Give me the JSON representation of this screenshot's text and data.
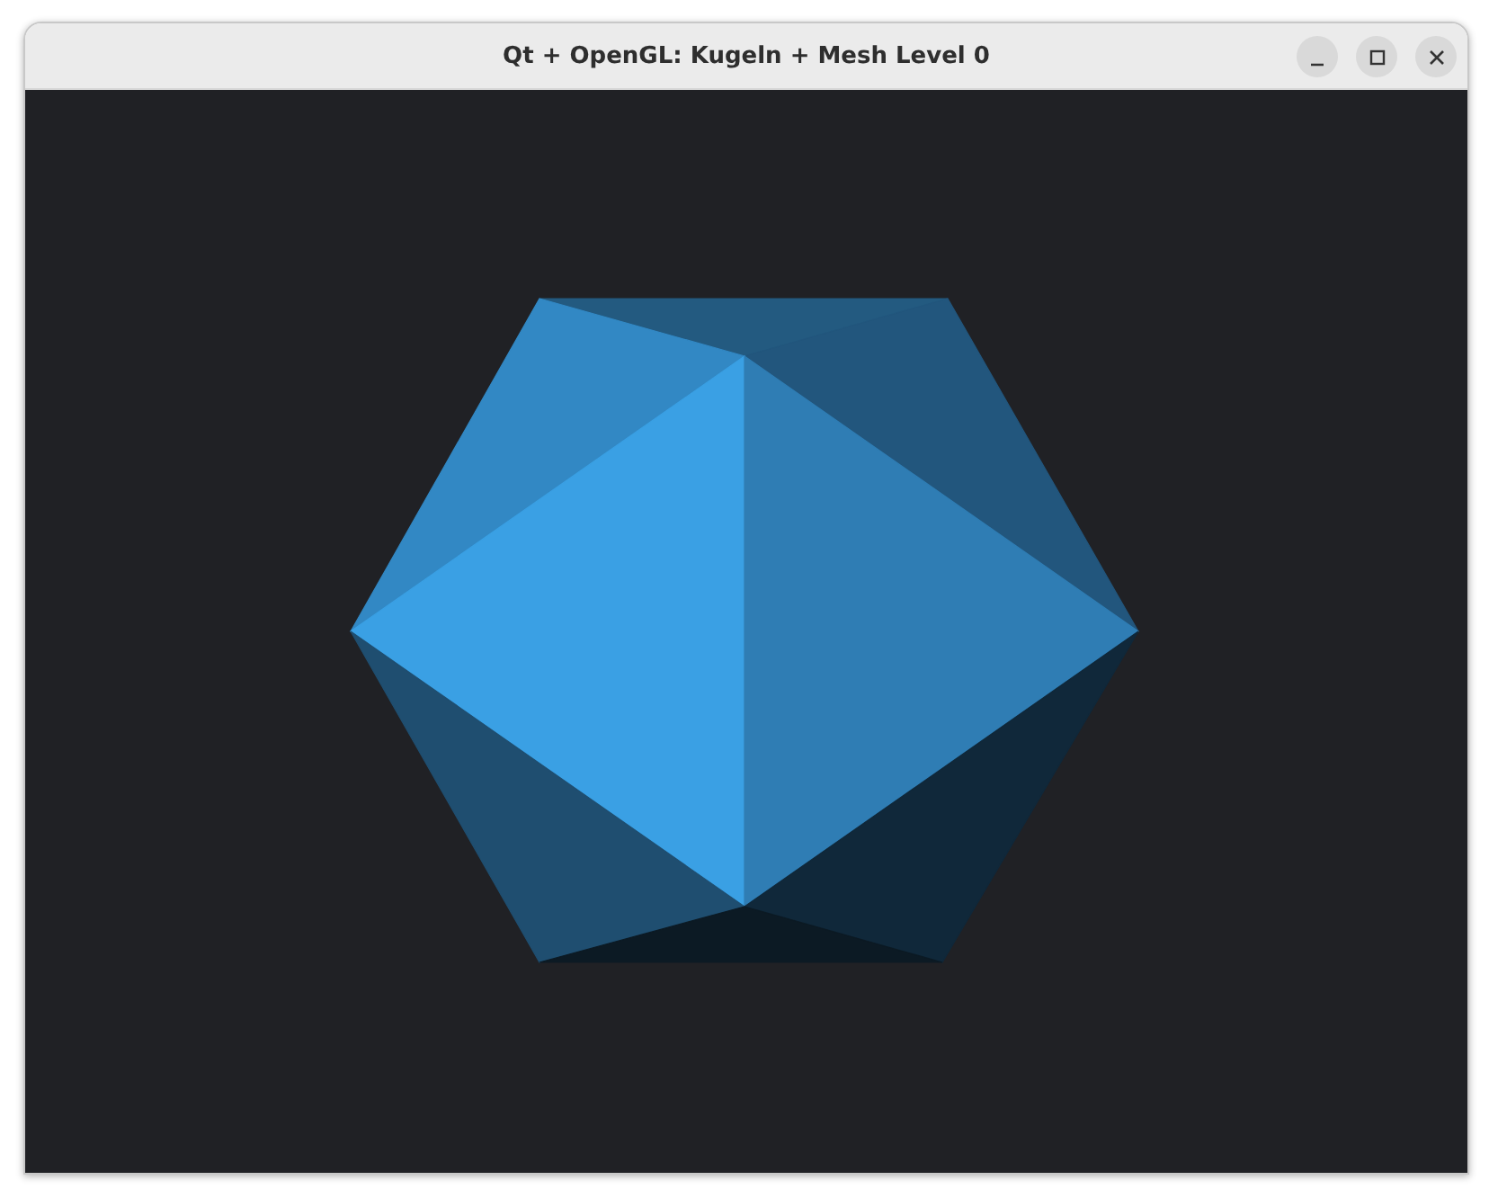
{
  "window": {
    "title": "Qt + OpenGL: Kugeln + Mesh Level 0"
  }
}
